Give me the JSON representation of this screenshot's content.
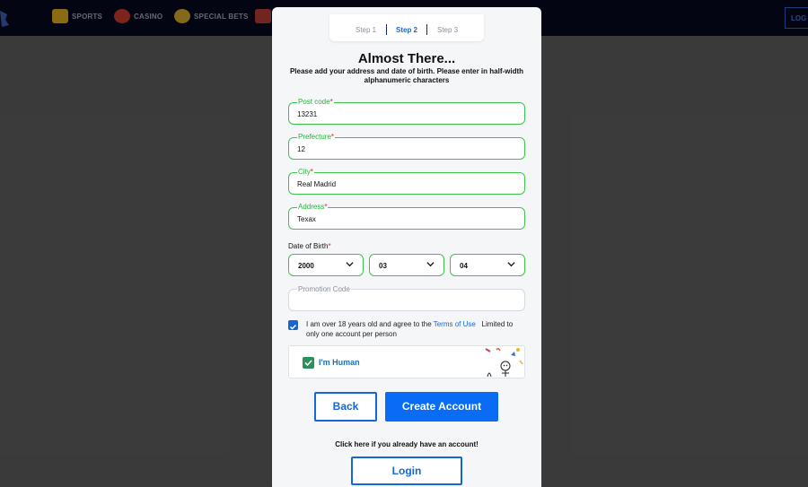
{
  "nav": {
    "items": [
      {
        "label": "SPORTS",
        "icon": "sports-icon",
        "color": "#d4a31c"
      },
      {
        "label": "CASINO",
        "icon": "casino-icon",
        "color": "#c0392b"
      },
      {
        "label": "SPECIAL BETS",
        "icon": "special-bets-icon",
        "color": "#c9a227"
      }
    ],
    "login_label": "LOG"
  },
  "steps": {
    "step1": "Step 1",
    "step2": "Step 2",
    "step3": "Step 3",
    "active": "Step 2"
  },
  "form": {
    "title": "Almost There...",
    "subtitle": "Please add your address and date of birth. Please enter in half-width alphanumeric characters",
    "post_code": {
      "label": "Post code",
      "value": "13231"
    },
    "prefecture": {
      "label": "Prefecture",
      "value": "12"
    },
    "city": {
      "label": "City",
      "value": "Real Madrid"
    },
    "address": {
      "label": "Address",
      "value": "Texax"
    },
    "required_mark": "*",
    "dob": {
      "label": "Date of Birth",
      "year": "2000",
      "month": "03",
      "day": "04"
    },
    "promo": {
      "placeholder": "Promotion Code"
    },
    "agree": {
      "checked": true,
      "text_before": "I am over 18 years old and agree to the",
      "link": "Terms of Use",
      "text_after": "Limited to only one account per person"
    },
    "captcha": {
      "label": "I'm Human",
      "checked": true
    },
    "back_label": "Back",
    "create_label": "Create Account",
    "already_text": "Click here if you already have an account!",
    "login_label": "Login"
  },
  "colors": {
    "accent": "#1566d6",
    "valid_border": "#3ec24e",
    "required": "#e0232e",
    "primary_button": "#0a6cf5"
  }
}
